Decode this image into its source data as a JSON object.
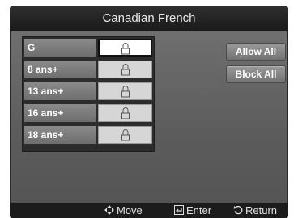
{
  "window": {
    "title": "Canadian French"
  },
  "ratings": [
    {
      "label": "G",
      "locked": false,
      "selected": true
    },
    {
      "label": "8 ans+",
      "locked": false,
      "selected": false
    },
    {
      "label": "13 ans+",
      "locked": false,
      "selected": false
    },
    {
      "label": "16 ans+",
      "locked": false,
      "selected": false
    },
    {
      "label": "18 ans+",
      "locked": false,
      "selected": false
    }
  ],
  "actions": {
    "allow_all": "Allow All",
    "block_all": "Block All"
  },
  "footer": {
    "move_icon": "move-arrows-icon",
    "move_label": "Move",
    "enter_icon": "enter-icon",
    "enter_label": "Enter",
    "return_icon": "return-icon",
    "return_label": "Return"
  },
  "colors": {
    "background": "#2a2a2a",
    "panel": "#636363",
    "label_bg": "#7c7c7c",
    "lock_bg": "#d6d6d6",
    "selected_lock_bg": "#ffffff"
  }
}
